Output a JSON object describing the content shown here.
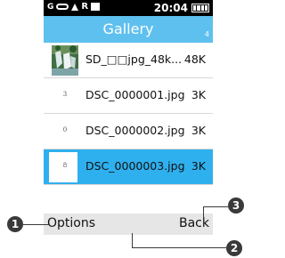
{
  "status_bar": {
    "network": "G",
    "time": "20:04",
    "icons": [
      "voicemail-icon",
      "upload-arrow-icon",
      "roaming-r-icon",
      "message-icon",
      "battery-icon"
    ],
    "roaming": "R"
  },
  "header": {
    "title": "Gallery",
    "count": "4"
  },
  "list": {
    "items": [
      {
        "index": "",
        "name": "SD_□□jpg_48k...",
        "size": "48K",
        "thumbnail": "waterfall-thumbnail"
      },
      {
        "index": "3",
        "name": "DSC_0000001.jpg",
        "size": "3K"
      },
      {
        "index": "0",
        "name": "DSC_0000002.jpg",
        "size": "3K"
      },
      {
        "index": "8",
        "name": "DSC_0000003.jpg",
        "size": "3K",
        "selected": true
      }
    ]
  },
  "softkeys": {
    "left": "Options",
    "right": "Back"
  },
  "callouts": [
    "1",
    "2",
    "3"
  ],
  "colors": {
    "header_bg": "#5ec0ee",
    "selected_bg": "#2fb0ee",
    "softkey_bg": "#e6e6e6",
    "callout_bg": "#3a3a3a"
  }
}
